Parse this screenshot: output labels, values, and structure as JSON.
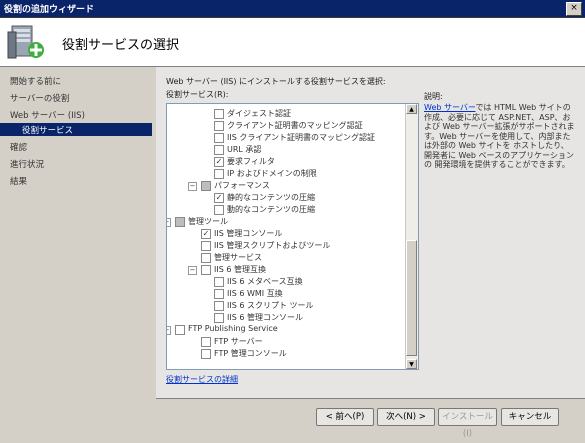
{
  "window": {
    "title": "役割の追加ウィザード",
    "close_glyph": "×"
  },
  "header": {
    "title": "役割サービスの選択",
    "icon": "server-add-icon"
  },
  "nav": {
    "items": [
      {
        "label": "開始する前に",
        "selected": false
      },
      {
        "label": "サーバーの役割",
        "selected": false
      },
      {
        "label": "Web サーバー (IIS)",
        "selected": false
      },
      {
        "label": "役割サービス",
        "selected": true
      },
      {
        "label": "確認",
        "selected": false
      },
      {
        "label": "進行状況",
        "selected": false
      },
      {
        "label": "結果",
        "selected": false
      }
    ]
  },
  "main": {
    "instruction": "Web サーバー (IIS) にインストールする役割サービスを選択:",
    "list_label": "役割サービス(R):",
    "tree": [
      {
        "label": "ダイジェスト認証",
        "state": "unchecked",
        "level": 3
      },
      {
        "label": "クライアント証明書のマッピング認証",
        "state": "unchecked",
        "level": 3
      },
      {
        "label": "IIS クライアント証明書のマッピング認証",
        "state": "unchecked",
        "level": 3
      },
      {
        "label": "URL 承認",
        "state": "unchecked",
        "level": 3
      },
      {
        "label": "要求フィルタ",
        "state": "checked",
        "level": 3
      },
      {
        "label": "IP およびドメインの制限",
        "state": "unchecked",
        "level": 3
      },
      {
        "label": "パフォーマンス",
        "state": "partial",
        "level": 2,
        "expander": "−"
      },
      {
        "label": "静的なコンテンツの圧縮",
        "state": "checked",
        "level": 3
      },
      {
        "label": "動的なコンテンツの圧縮",
        "state": "unchecked",
        "level": 3
      },
      {
        "label": "管理ツール",
        "state": "partial",
        "level": 1,
        "expander": "−"
      },
      {
        "label": "IIS 管理コンソール",
        "state": "checked",
        "level": 2
      },
      {
        "label": "IIS 管理スクリプトおよびツール",
        "state": "unchecked",
        "level": 2
      },
      {
        "label": "管理サービス",
        "state": "unchecked",
        "level": 2
      },
      {
        "label": "IIS 6 管理互換",
        "state": "unchecked",
        "level": 2,
        "expander": "−"
      },
      {
        "label": "IIS 6 メタベース互換",
        "state": "unchecked",
        "level": 3
      },
      {
        "label": "IIS 6 WMI 互換",
        "state": "unchecked",
        "level": 3
      },
      {
        "label": "IIS 6 スクリプト ツール",
        "state": "unchecked",
        "level": 3
      },
      {
        "label": "IIS 6 管理コンソール",
        "state": "unchecked",
        "level": 3
      },
      {
        "label": "FTP Publishing Service",
        "state": "unchecked",
        "level": 1,
        "expander": "−"
      },
      {
        "label": "FTP サーバー",
        "state": "unchecked",
        "level": 2
      },
      {
        "label": "FTP 管理コンソール",
        "state": "unchecked",
        "level": 2
      }
    ],
    "more_link": "役割サービスの詳細",
    "description": {
      "title": "説明:",
      "link": "Web サーバー",
      "text": "では HTML Web サイトの作成、必要に応じて ASP.NET、ASP、および Web サーバー拡張がサポートされます。Web サーバーを使用して、内部または外部の Web サイトを ホストしたり、開発者に Web ベースのアプリケーションの 開発環境を提供することができます。"
    }
  },
  "buttons": {
    "prev": "< 前へ(P)",
    "next": "次へ(N) >",
    "install": "インストール(I)",
    "cancel": "キャンセル"
  }
}
